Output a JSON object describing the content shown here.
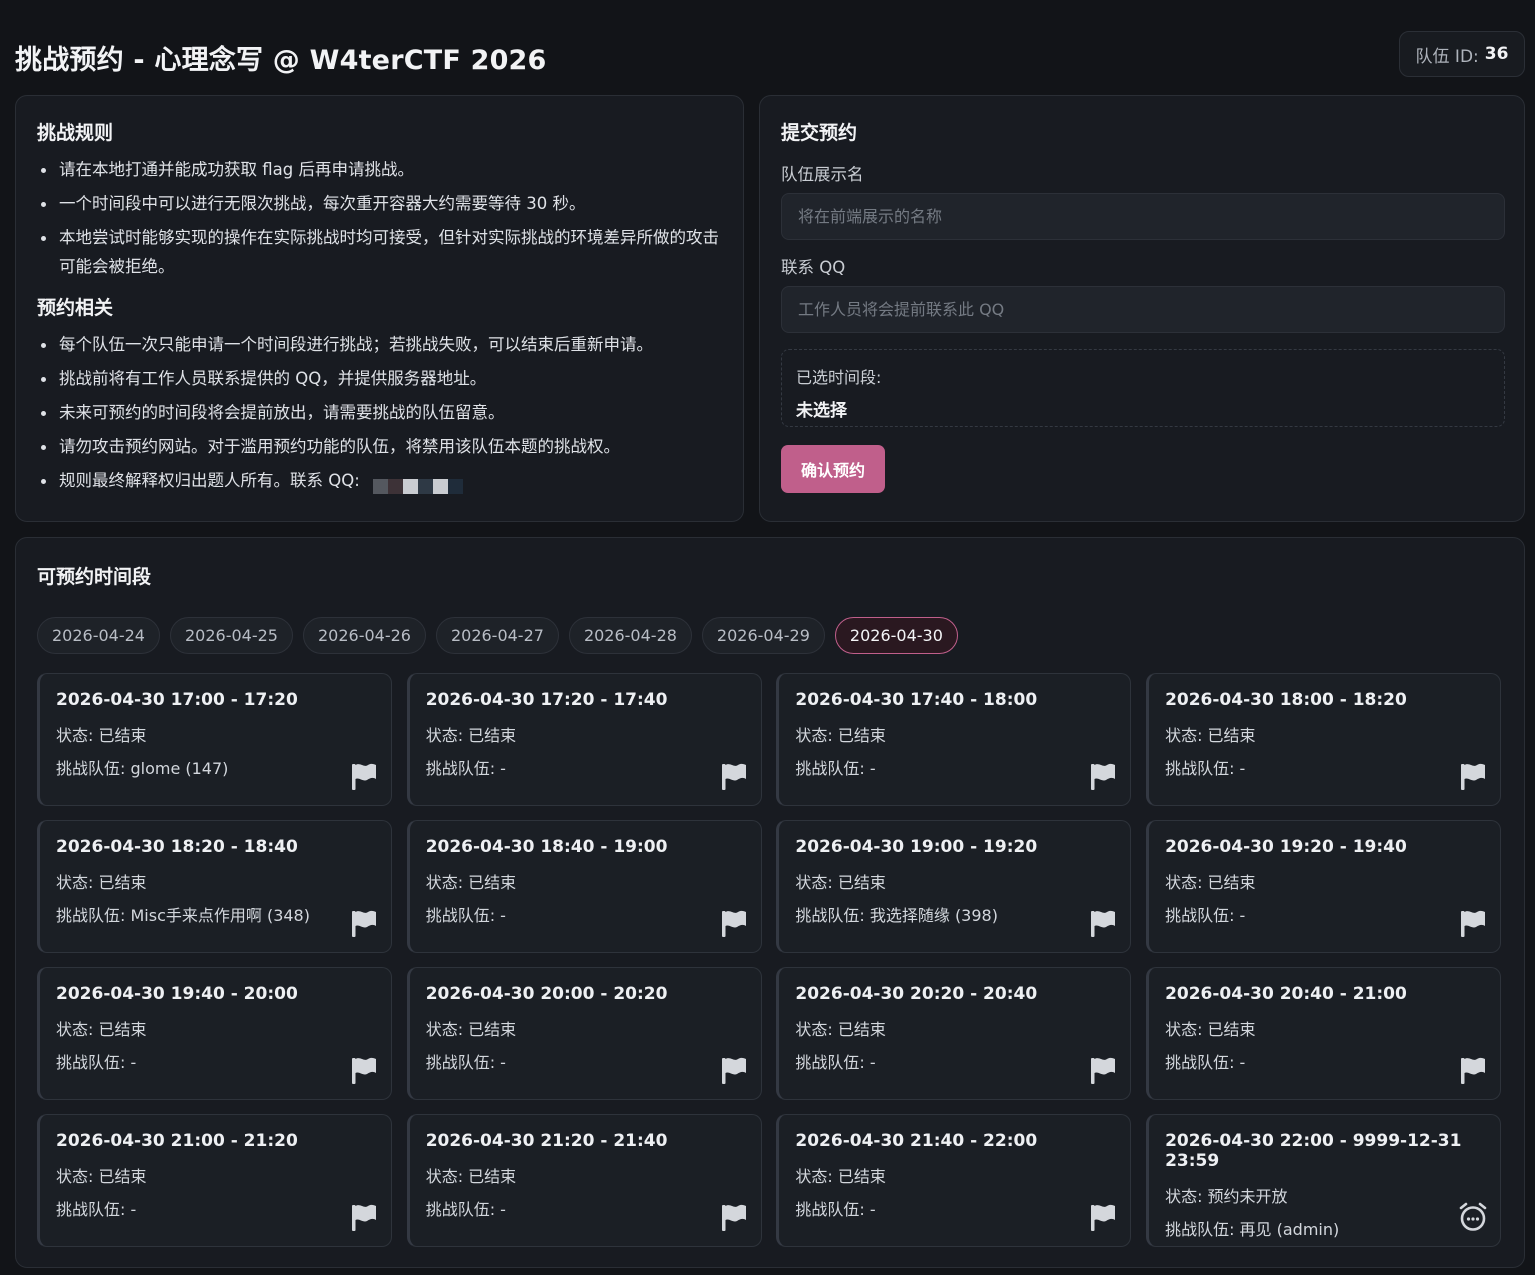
{
  "header": {
    "title": "挑战预约 - 心理念写 @ W4terCTF 2026",
    "team_id_label": "队伍 ID:",
    "team_id_value": "36"
  },
  "rules": {
    "title": "挑战规则",
    "items": [
      "请在本地打通并能成功获取 flag 后再申请挑战。",
      "一个时间段中可以进行无限次挑战，每次重开容器大约需要等待 30 秒。",
      "本地尝试时能够实现的操作在实际挑战时均可接受，但针对实际挑战的环境差异所做的攻击可能会被拒绝。"
    ],
    "booking_title": "预约相关",
    "booking_items": [
      "每个队伍一次只能申请一个时间段进行挑战；若挑战失败，可以结束后重新申请。",
      "挑战前将有工作人员联系提供的 QQ，并提供服务器地址。",
      "未来可预约的时间段将会提前放出，请需要挑战的队伍留意。",
      "请勿攻击预约网站。对于滥用预约功能的队伍，将禁用该队伍本题的挑战权。",
      "规则最终解释权归出题人所有。联系 QQ:"
    ]
  },
  "submit": {
    "title": "提交预约",
    "team_name_label": "队伍展示名",
    "team_name_placeholder": "将在前端展示的名称",
    "qq_label": "联系 QQ",
    "qq_placeholder": "工作人员将会提前联系此 QQ",
    "selected_label": "已选时间段:",
    "selected_value": "未选择",
    "confirm_label": "确认预约"
  },
  "slots_section": {
    "title": "可预约时间段",
    "dates": [
      "2026-04-24",
      "2026-04-25",
      "2026-04-26",
      "2026-04-27",
      "2026-04-28",
      "2026-04-29",
      "2026-04-30"
    ],
    "active_date": "2026-04-30",
    "slots": [
      {
        "time": "2026-04-30 17:00 - 17:20",
        "status": "状态: 已结束",
        "team": "挑战队伍: glome (147)",
        "icon": "flag-icon"
      },
      {
        "time": "2026-04-30 17:20 - 17:40",
        "status": "状态: 已结束",
        "team": "挑战队伍: -",
        "icon": "flag-icon"
      },
      {
        "time": "2026-04-30 17:40 - 18:00",
        "status": "状态: 已结束",
        "team": "挑战队伍: -",
        "icon": "flag-icon"
      },
      {
        "time": "2026-04-30 18:00 - 18:20",
        "status": "状态: 已结束",
        "team": "挑战队伍: -",
        "icon": "flag-icon"
      },
      {
        "time": "2026-04-30 18:20 - 18:40",
        "status": "状态: 已结束",
        "team": "挑战队伍: Misc手来点作用啊 (348)",
        "icon": "flag-icon"
      },
      {
        "time": "2026-04-30 18:40 - 19:00",
        "status": "状态: 已结束",
        "team": "挑战队伍: -",
        "icon": "flag-icon"
      },
      {
        "time": "2026-04-30 19:00 - 19:20",
        "status": "状态: 已结束",
        "team": "挑战队伍: 我选择随缘 (398)",
        "icon": "flag-icon"
      },
      {
        "time": "2026-04-30 19:20 - 19:40",
        "status": "状态: 已结束",
        "team": "挑战队伍: -",
        "icon": "flag-icon"
      },
      {
        "time": "2026-04-30 19:40 - 20:00",
        "status": "状态: 已结束",
        "team": "挑战队伍: -",
        "icon": "flag-icon"
      },
      {
        "time": "2026-04-30 20:00 - 20:20",
        "status": "状态: 已结束",
        "team": "挑战队伍: -",
        "icon": "flag-icon"
      },
      {
        "time": "2026-04-30 20:20 - 20:40",
        "status": "状态: 已结束",
        "team": "挑战队伍: -",
        "icon": "flag-icon"
      },
      {
        "time": "2026-04-30 20:40 - 21:00",
        "status": "状态: 已结束",
        "team": "挑战队伍: -",
        "icon": "flag-icon"
      },
      {
        "time": "2026-04-30 21:00 - 21:20",
        "status": "状态: 已结束",
        "team": "挑战队伍: -",
        "icon": "flag-icon"
      },
      {
        "time": "2026-04-30 21:20 - 21:40",
        "status": "状态: 已结束",
        "team": "挑战队伍: -",
        "icon": "flag-icon"
      },
      {
        "time": "2026-04-30 21:40 - 22:00",
        "status": "状态: 已结束",
        "team": "挑战队伍: -",
        "icon": "flag-icon"
      },
      {
        "time": "2026-04-30 22:00 - 9999-12-31 23:59",
        "status": "状态: 预约未开放",
        "team": "挑战队伍: 再见 (admin)",
        "icon": "alarm-clock-icon"
      }
    ]
  },
  "colors": {
    "accent": "#c05f8b",
    "background": "#121418",
    "panel": "#181b21"
  }
}
